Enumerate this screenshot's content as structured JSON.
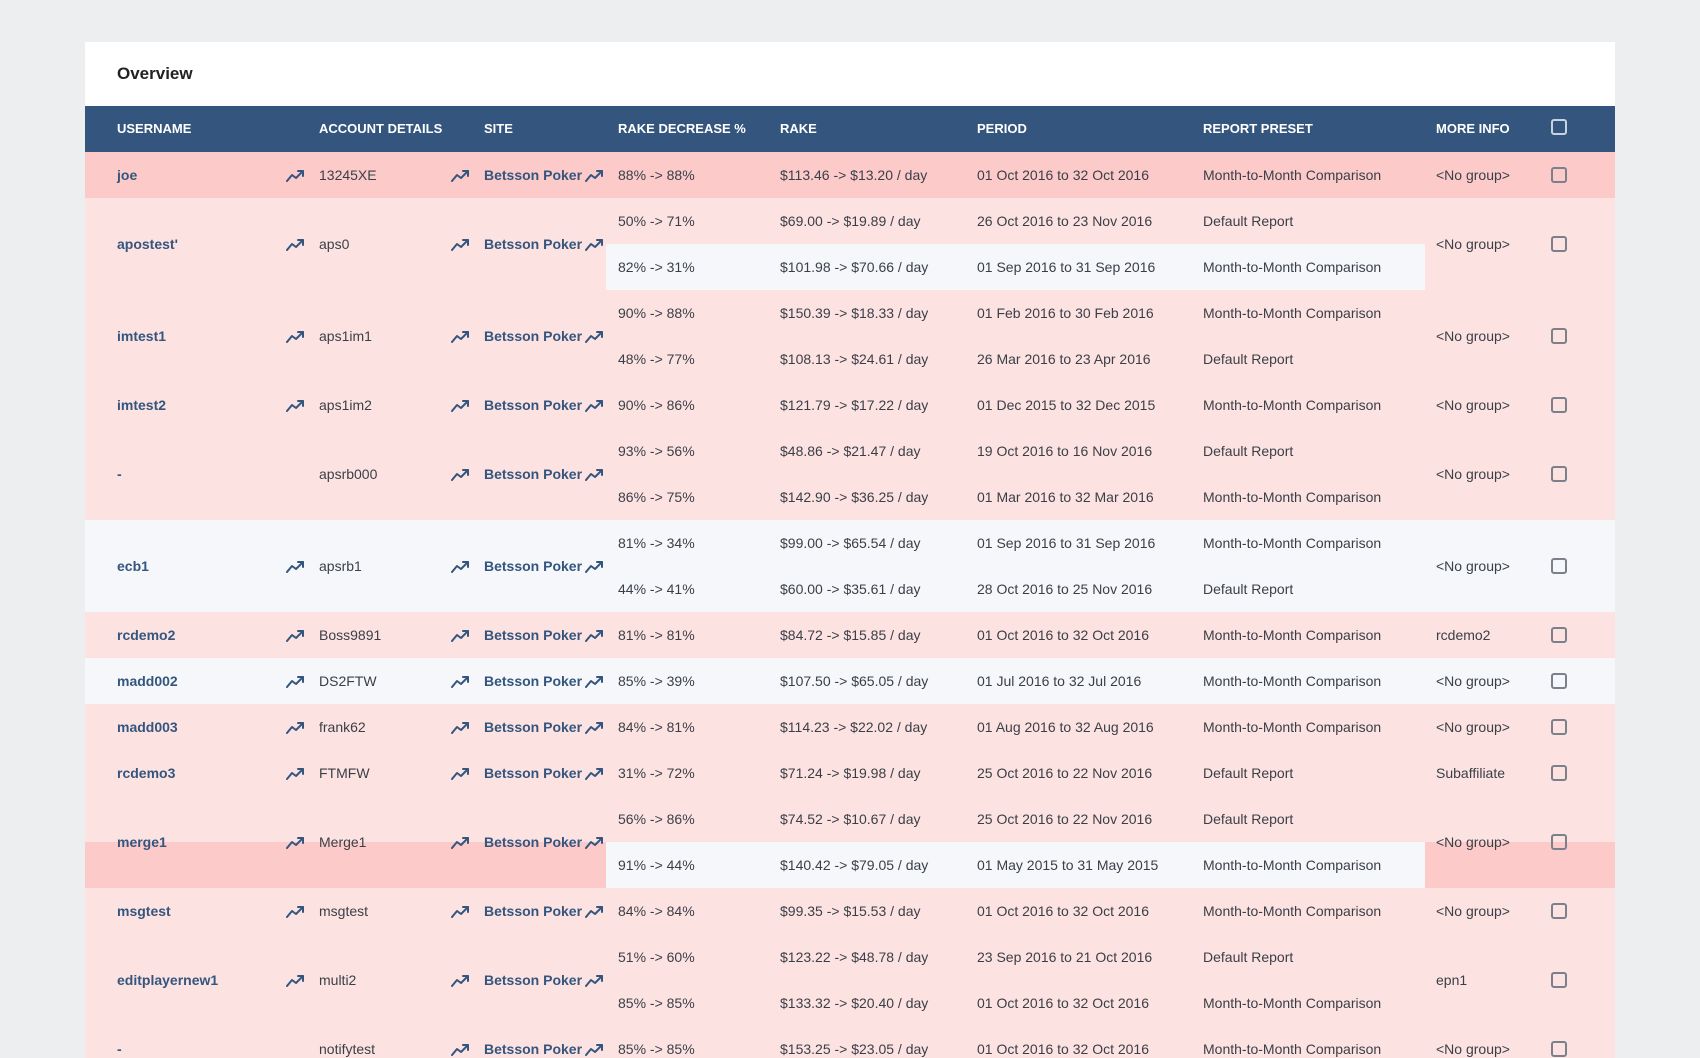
{
  "panel": {
    "title": "Overview"
  },
  "columns": {
    "username": "USERNAME",
    "account_details": "ACCOUNT DETAILS",
    "site": "SITE",
    "rake_decrease": "RAKE DECREASE %",
    "rake": "RAKE",
    "period": "PERIOD",
    "report_preset": "REPORT PRESET",
    "more_info": "MORE INFO"
  },
  "icons": {
    "trend": "trending-up-icon",
    "checkbox": "checkbox-icon"
  },
  "colors": {
    "header_bg": "#34567e",
    "row_pink": "#fde2e2",
    "row_pink_dark": "#fdcaca",
    "row_gray": "#f5f7fa",
    "link": "#34567e"
  },
  "rows": [
    {
      "username": "joe",
      "account": "13245XE",
      "site": "Betsson Poker",
      "more_info": "<No group>",
      "reports": [
        {
          "rake_decrease": "88% -> 88%",
          "rake": "$113.46 -> $13.20 / day",
          "period": "01 Oct 2016 to 32 Oct 2016",
          "preset": "Month-to-Month Comparison"
        }
      ]
    },
    {
      "username": "apostest'",
      "account": "aps0",
      "site": "Betsson Poker",
      "more_info": "<No group>",
      "reports": [
        {
          "rake_decrease": "50% -> 71%",
          "rake": "$69.00 -> $19.89 / day",
          "period": "26 Oct 2016 to 23 Nov 2016",
          "preset": "Default Report"
        },
        {
          "rake_decrease": "82% -> 31%",
          "rake": "$101.98 -> $70.66 / day",
          "period": "01 Sep 2016 to 31 Sep 2016",
          "preset": "Month-to-Month Comparison"
        }
      ]
    },
    {
      "username": "imtest1",
      "account": "aps1im1",
      "site": "Betsson Poker",
      "more_info": "<No group>",
      "reports": [
        {
          "rake_decrease": "90% -> 88%",
          "rake": "$150.39 -> $18.33 / day",
          "period": "01 Feb 2016 to 30 Feb 2016",
          "preset": "Month-to-Month Comparison"
        },
        {
          "rake_decrease": "48% -> 77%",
          "rake": "$108.13 -> $24.61 / day",
          "period": "26 Mar 2016 to 23 Apr 2016",
          "preset": "Default Report"
        }
      ]
    },
    {
      "username": "imtest2",
      "account": "aps1im2",
      "site": "Betsson Poker",
      "more_info": "<No group>",
      "reports": [
        {
          "rake_decrease": "90% -> 86%",
          "rake": "$121.79 -> $17.22 / day",
          "period": "01 Dec 2015 to 32 Dec 2015",
          "preset": "Month-to-Month Comparison"
        }
      ]
    },
    {
      "username": "-",
      "account": "apsrb000",
      "site": "Betsson Poker",
      "more_info": "<No group>",
      "reports": [
        {
          "rake_decrease": "93% -> 56%",
          "rake": "$48.86 -> $21.47 / day",
          "period": "19 Oct 2016 to 16 Nov 2016",
          "preset": "Default Report"
        },
        {
          "rake_decrease": "86% -> 75%",
          "rake": "$142.90 -> $36.25 / day",
          "period": "01 Mar 2016 to 32 Mar 2016",
          "preset": "Month-to-Month Comparison"
        }
      ]
    },
    {
      "username": "ecb1",
      "account": "apsrb1",
      "site": "Betsson Poker",
      "more_info": "<No group>",
      "reports": [
        {
          "rake_decrease": "81% -> 34%",
          "rake": "$99.00 -> $65.54 / day",
          "period": "01 Sep 2016 to 31 Sep 2016",
          "preset": "Month-to-Month Comparison"
        },
        {
          "rake_decrease": "44% -> 41%",
          "rake": "$60.00 -> $35.61 / day",
          "period": "28 Oct 2016 to 25 Nov 2016",
          "preset": "Default Report"
        }
      ]
    },
    {
      "username": "rcdemo2",
      "account": "Boss9891",
      "site": "Betsson Poker",
      "more_info": "rcdemo2",
      "reports": [
        {
          "rake_decrease": "81% -> 81%",
          "rake": "$84.72 -> $15.85 / day",
          "period": "01 Oct 2016 to 32 Oct 2016",
          "preset": "Month-to-Month Comparison"
        }
      ]
    },
    {
      "username": "madd002",
      "account": "DS2FTW",
      "site": "Betsson Poker",
      "more_info": "<No group>",
      "reports": [
        {
          "rake_decrease": "85% -> 39%",
          "rake": "$107.50 -> $65.05 / day",
          "period": "01 Jul 2016 to 32 Jul 2016",
          "preset": "Month-to-Month Comparison"
        }
      ]
    },
    {
      "username": "madd003",
      "account": "frank62",
      "site": "Betsson Poker",
      "more_info": "<No group>",
      "reports": [
        {
          "rake_decrease": "84% -> 81%",
          "rake": "$114.23 -> $22.02 / day",
          "period": "01 Aug 2016 to 32 Aug 2016",
          "preset": "Month-to-Month Comparison"
        }
      ]
    },
    {
      "username": "rcdemo3",
      "account": "FTMFW",
      "site": "Betsson Poker",
      "more_info": "Subaffiliate",
      "reports": [
        {
          "rake_decrease": "31% -> 72%",
          "rake": "$71.24 -> $19.98 / day",
          "period": "25 Oct 2016 to 22 Nov 2016",
          "preset": "Default Report"
        }
      ]
    },
    {
      "username": "merge1",
      "account": "Merge1",
      "site": "Betsson Poker",
      "more_info": "<No group>",
      "reports": [
        {
          "rake_decrease": "56% -> 86%",
          "rake": "$74.52 -> $10.67 / day",
          "period": "25 Oct 2016 to 22 Nov 2016",
          "preset": "Default Report"
        },
        {
          "rake_decrease": "91% -> 44%",
          "rake": "$140.42 -> $79.05 / day",
          "period": "01 May 2015 to 31 May 2015",
          "preset": "Month-to-Month Comparison"
        }
      ]
    },
    {
      "username": "msgtest",
      "account": "msgtest",
      "site": "Betsson Poker",
      "more_info": "<No group>",
      "reports": [
        {
          "rake_decrease": "84% -> 84%",
          "rake": "$99.35 -> $15.53 / day",
          "period": "01 Oct 2016 to 32 Oct 2016",
          "preset": "Month-to-Month Comparison"
        }
      ]
    },
    {
      "username": "editplayernew1",
      "account": "multi2",
      "site": "Betsson Poker",
      "more_info": "epn1",
      "reports": [
        {
          "rake_decrease": "51% -> 60%",
          "rake": "$123.22 -> $48.78 / day",
          "period": "23 Sep 2016 to 21 Oct 2016",
          "preset": "Default Report"
        },
        {
          "rake_decrease": "85% -> 85%",
          "rake": "$133.32 -> $20.40 / day",
          "period": "01 Oct 2016 to 32 Oct 2016",
          "preset": "Month-to-Month Comparison"
        }
      ]
    },
    {
      "username": "-",
      "account": "notifytest",
      "site": "Betsson Poker",
      "more_info": "<No group>",
      "reports": [
        {
          "rake_decrease": "85% -> 85%",
          "rake": "$153.25 -> $23.05 / day",
          "period": "01 Oct 2016 to 32 Oct 2016",
          "preset": "Month-to-Month Comparison"
        }
      ]
    }
  ]
}
